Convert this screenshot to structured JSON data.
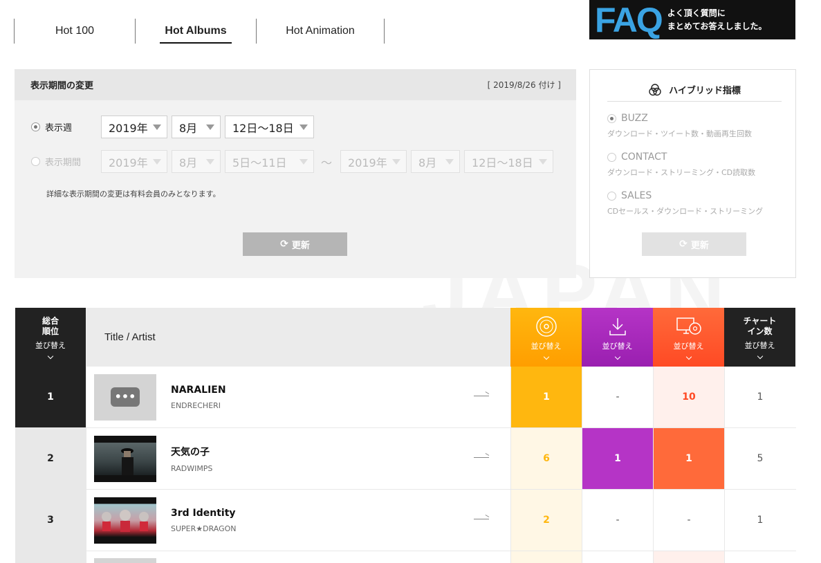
{
  "tabs": [
    {
      "label": "Hot 100"
    },
    {
      "label": "Hot Albums"
    },
    {
      "label": "Hot Animation"
    }
  ],
  "faq": {
    "big": "FAQ",
    "line1": "よく頂く質問に",
    "line2": "まとめてお答えしました。"
  },
  "period": {
    "title": "表示期間の変更",
    "date_note": "[ 2019/8/26 付け ]",
    "week_label": "表示週",
    "week_year": "2019年",
    "week_month": "8月",
    "week_days": "12日～18日",
    "range_label": "表示期間",
    "from_year": "2019年",
    "from_month": "8月",
    "from_days": "5日～11日",
    "tilde": "～",
    "to_year": "2019年",
    "to_month": "8月",
    "to_days": "12日～18日",
    "note": "詳細な表示期間の変更は有料会員のみとなります。",
    "update_label": "更新"
  },
  "hybrid": {
    "title": "ハイブリッド指標",
    "options": [
      {
        "name": "BUZZ",
        "desc": "ダウンロード・ツイート数・動画再生回数"
      },
      {
        "name": "CONTACT",
        "desc": "ダウンロード・ストリーミング・CD読取数"
      },
      {
        "name": "SALES",
        "desc": "CDセールス・ダウンロード・ストリーミング"
      }
    ],
    "update_label": "更新"
  },
  "watermark": "JAPAN",
  "table": {
    "rank_header_l1": "総合",
    "rank_header_l2": "順位",
    "title_header": "Title / Artist",
    "sort_label": "並び替え",
    "count_header_l1": "チャート",
    "count_header_l2": "イン数",
    "rows": [
      {
        "rank": "1",
        "song": "NARALIEN",
        "artist": "ENDRECHERI",
        "physical": "1",
        "download": "-",
        "streaming": "10",
        "count": "1"
      },
      {
        "rank": "2",
        "song": "天気の子",
        "artist": "RADWIMPS",
        "physical": "6",
        "download": "1",
        "streaming": "1",
        "count": "5"
      },
      {
        "rank": "3",
        "song": "3rd Identity",
        "artist": "SUPER★DRAGON",
        "physical": "2",
        "download": "-",
        "streaming": "-",
        "count": "1"
      }
    ]
  },
  "colors": {
    "physical": "#ffb70f",
    "download": "#b534c6",
    "streaming": "#ff6a3a",
    "dark": "#222222"
  }
}
